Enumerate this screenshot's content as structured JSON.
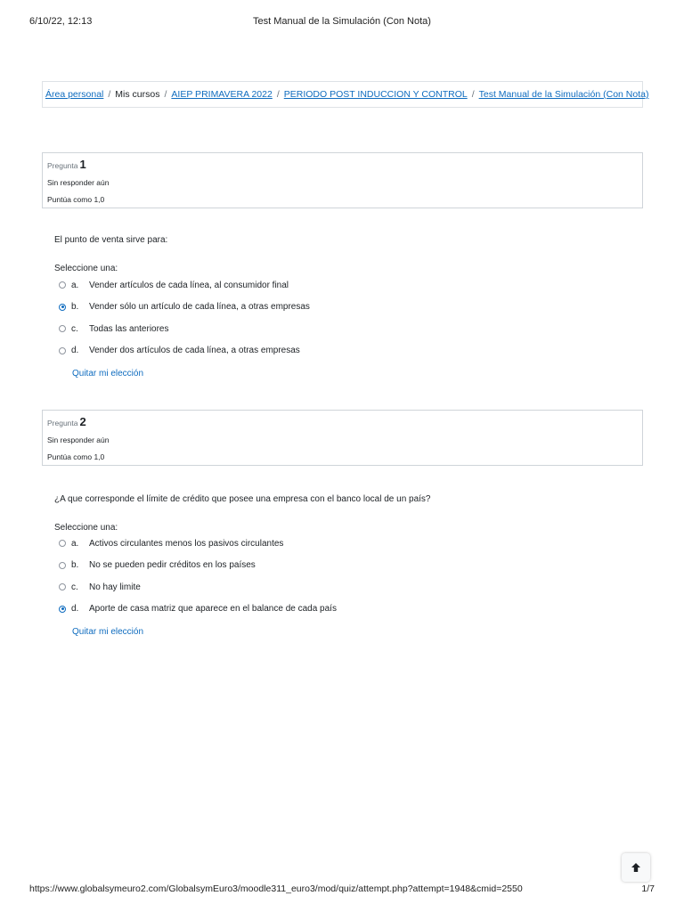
{
  "print_header": {
    "date": "6/10/22, 12:13",
    "title": "Test Manual de la Simulación (Con Nota)"
  },
  "breadcrumb": {
    "items": [
      {
        "label": "Área personal",
        "link": true
      },
      {
        "label": "Mis cursos",
        "link": false
      },
      {
        "label": "AIEP PRIMAVERA 2022",
        "link": true
      },
      {
        "label": "PERIODO POST INDUCCION Y CONTROL",
        "link": true
      },
      {
        "label": "Test Manual de la Simulación (Con Nota)",
        "link": true
      }
    ],
    "separator": "/"
  },
  "questions": [
    {
      "label": "Pregunta",
      "number": "1",
      "state": "Sin responder aún",
      "grade": "Puntúa como 1,0",
      "text": "El punto de venta sirve para:",
      "prompt": "Seleccione una:",
      "answers": [
        {
          "letter": "a.",
          "text": "Vender artículos de cada línea, al consumidor final",
          "checked": false
        },
        {
          "letter": "b.",
          "text": "Vender sólo un artículo de cada línea, a otras empresas",
          "checked": true
        },
        {
          "letter": "c.",
          "text": "Todas las anteriores",
          "checked": false
        },
        {
          "letter": "d.",
          "text": "Vender dos artículos de cada línea, a otras empresas",
          "checked": false
        }
      ],
      "clear_label": "Quitar mi elección"
    },
    {
      "label": "Pregunta",
      "number": "2",
      "state": "Sin responder aún",
      "grade": "Puntúa como 1,0",
      "text": "¿A que corresponde el límite de crédito que posee una empresa con el banco local de un país?",
      "prompt": "Seleccione una:",
      "answers": [
        {
          "letter": "a.",
          "text": "Activos circulantes menos los pasivos circulantes",
          "checked": false
        },
        {
          "letter": "b.",
          "text": "No se pueden pedir créditos en los países",
          "checked": false
        },
        {
          "letter": "c.",
          "text": "No hay limite",
          "checked": false
        },
        {
          "letter": "d.",
          "text": "Aporte de casa matriz que aparece en el balance de cada país",
          "checked": true
        }
      ],
      "clear_label": "Quitar mi elección"
    }
  ],
  "back_to_top": {
    "icon": "arrow-up-icon"
  },
  "footer": {
    "url": "https://www.globalsymeuro2.com/GlobalsymEuro3/moodle311_euro3/mod/quiz/attempt.php?attempt=1948&cmid=2550",
    "page": "1/7"
  },
  "colors": {
    "link": "#0f6cbf",
    "border": "#cfd4d9",
    "text": "#1d2125"
  }
}
